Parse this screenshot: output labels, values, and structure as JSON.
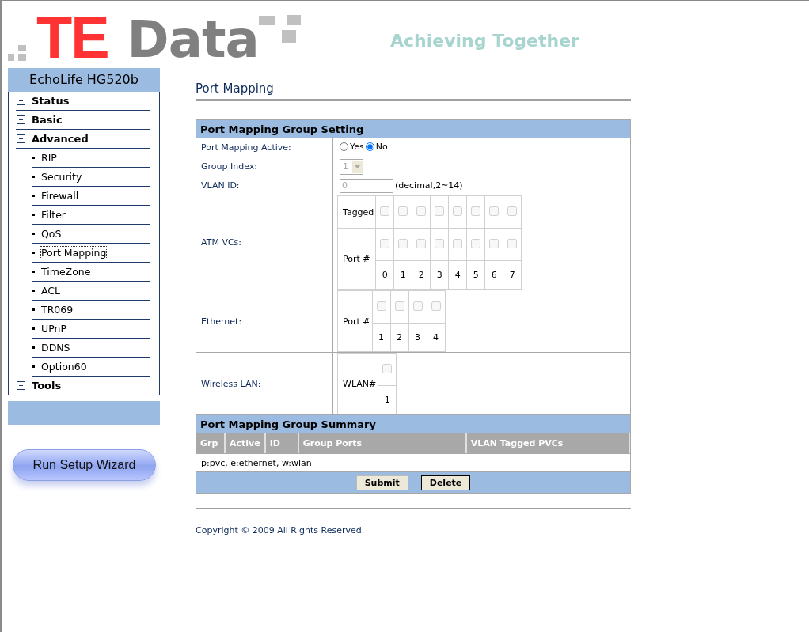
{
  "header": {
    "logo_left": "TE",
    "logo_right": "Data",
    "tagline": "Achieving Together"
  },
  "sidebar": {
    "title": "EchoLife HG520b",
    "items": [
      {
        "label": "Status",
        "expanded": false
      },
      {
        "label": "Basic",
        "expanded": false
      },
      {
        "label": "Advanced",
        "expanded": true,
        "children": [
          {
            "label": "RIP",
            "selected": false
          },
          {
            "label": "Security",
            "selected": false
          },
          {
            "label": "Firewall",
            "selected": false
          },
          {
            "label": "Filter",
            "selected": false
          },
          {
            "label": "QoS",
            "selected": false
          },
          {
            "label": "Port Mapping",
            "selected": true
          },
          {
            "label": "TimeZone",
            "selected": false
          },
          {
            "label": "ACL",
            "selected": false
          },
          {
            "label": "TR069",
            "selected": false
          },
          {
            "label": "UPnP",
            "selected": false
          },
          {
            "label": "DDNS",
            "selected": false
          },
          {
            "label": "Option60",
            "selected": false
          }
        ]
      },
      {
        "label": "Tools",
        "expanded": false
      }
    ]
  },
  "wizard_button": "Run Setup Wizard",
  "page_title": "Port Mapping",
  "setting": {
    "title": "Port Mapping Group Setting",
    "active": {
      "label": "Port Mapping Active:",
      "options": [
        {
          "label": "Yes",
          "selected": false
        },
        {
          "label": "No",
          "selected": true
        }
      ]
    },
    "group_index": {
      "label": "Group Index:",
      "value": "1",
      "disabled": true
    },
    "vlan_id": {
      "label": "VLAN ID:",
      "value": "0",
      "hint": "(decimal,2~14)",
      "disabled": true
    },
    "atm": {
      "label": "ATM VCs:",
      "tagged_label": "Tagged",
      "port_label": "Port #",
      "ports": [
        {
          "number": "0",
          "tagged": false,
          "checked": false,
          "disabled": true
        },
        {
          "number": "1",
          "tagged": false,
          "checked": false,
          "disabled": true
        },
        {
          "number": "2",
          "tagged": false,
          "checked": false,
          "disabled": true
        },
        {
          "number": "3",
          "tagged": false,
          "checked": false,
          "disabled": true
        },
        {
          "number": "4",
          "tagged": false,
          "checked": false,
          "disabled": true
        },
        {
          "number": "5",
          "tagged": false,
          "checked": false,
          "disabled": true
        },
        {
          "number": "6",
          "tagged": false,
          "checked": false,
          "disabled": true
        },
        {
          "number": "7",
          "tagged": false,
          "checked": false,
          "disabled": true
        }
      ]
    },
    "ethernet": {
      "label": "Ethernet:",
      "port_label": "Port #",
      "ports": [
        {
          "number": "1",
          "checked": false,
          "disabled": true
        },
        {
          "number": "2",
          "checked": false,
          "disabled": true
        },
        {
          "number": "3",
          "checked": false,
          "disabled": true
        },
        {
          "number": "4",
          "checked": false,
          "disabled": true
        }
      ]
    },
    "wlan": {
      "label": "Wireless LAN:",
      "port_label": "WLAN#",
      "ports": [
        {
          "number": "1",
          "checked": false,
          "disabled": true
        }
      ]
    }
  },
  "summary": {
    "title": "Port Mapping Group Summary",
    "columns": [
      "Grp",
      "Active",
      "ID",
      "Group Ports",
      "VLAN Tagged PVCs"
    ],
    "legend": "p:pvc, e:ethernet, w:wlan"
  },
  "buttons": [
    {
      "label": "Submit",
      "focused": false
    },
    {
      "label": "Delete",
      "focused": true
    }
  ],
  "footer": "Copyright © 2009 All Rights Reserved."
}
